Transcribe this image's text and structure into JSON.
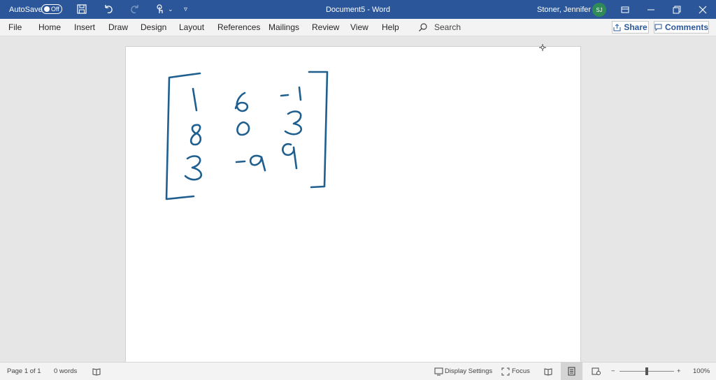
{
  "titlebar": {
    "autosave_label": "AutoSave",
    "autosave_state": "Off",
    "document_title": "Document5 - Word",
    "user_name": "Stoner, Jennifer L",
    "user_initials": "SJ",
    "icons": [
      "save-icon",
      "undo-icon",
      "redo-icon",
      "touch-mode-icon",
      "customize-quick-access-icon",
      "ribbon-display-options-icon",
      "minimize-icon",
      "restore-icon",
      "close-icon"
    ]
  },
  "ribbon": {
    "tabs": [
      "File",
      "Home",
      "Insert",
      "Draw",
      "Design",
      "Layout",
      "References",
      "Mailings",
      "Review",
      "View",
      "Help"
    ],
    "search_label": "Search",
    "share_label": "Share",
    "comments_label": "Comments"
  },
  "document": {
    "handwriting": {
      "description_type": "ink matrix",
      "rows": [
        [
          "1",
          "6",
          "-1"
        ],
        [
          "8",
          "0",
          "3"
        ],
        [
          "3",
          "-9",
          "9"
        ]
      ],
      "ink_color": "#1f5f8f"
    }
  },
  "statusbar": {
    "page_info": "Page 1 of 1",
    "word_count": "0 words",
    "display_settings": "Display Settings",
    "focus": "Focus",
    "zoom_minus": "−",
    "zoom_plus": "+",
    "zoom_level": "100%",
    "zoom_fraction": 0.5
  },
  "colors": {
    "titlebar": "#2b579a",
    "accent": "#2b579a",
    "ink": "#1f5f8f"
  }
}
